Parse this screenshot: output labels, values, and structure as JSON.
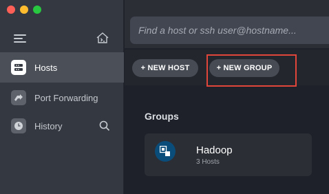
{
  "window": {
    "controls": [
      "close",
      "minimize",
      "zoom"
    ]
  },
  "sidebar": {
    "menu_icon": "hamburger-icon",
    "home_icon": "terminal-home-icon",
    "items": [
      {
        "label": "Hosts",
        "icon": "server-icon",
        "active": true
      },
      {
        "label": "Port Forwarding",
        "icon": "forward-arrow-icon",
        "active": false
      },
      {
        "label": "History",
        "icon": "clock-icon",
        "active": false
      }
    ],
    "search_icon": "magnifier-icon"
  },
  "search": {
    "placeholder": "Find a host or ssh user@hostname..."
  },
  "actions": {
    "new_host": "+ NEW HOST",
    "new_group": "+ NEW GROUP"
  },
  "groups": {
    "title": "Groups",
    "items": [
      {
        "name": "Hadoop",
        "count": "3 Hosts"
      }
    ]
  },
  "colors": {
    "highlight": "#e2453a",
    "group_avatar": "#0a4d7a"
  }
}
